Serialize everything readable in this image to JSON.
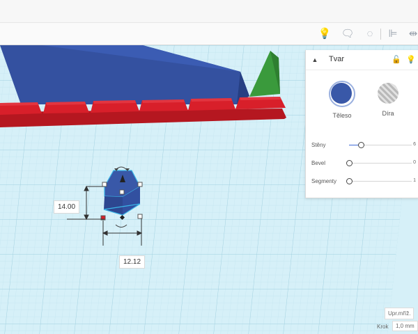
{
  "toolbar": {
    "tools": [
      {
        "name": "lightbulb-icon",
        "glyph": "💡"
      },
      {
        "name": "note-icon",
        "glyph": "🗨"
      },
      {
        "name": "comment-icon",
        "glyph": "◌"
      },
      {
        "name": "align-icon",
        "glyph": "⊫"
      },
      {
        "name": "mirror-icon",
        "glyph": "⇹"
      }
    ]
  },
  "dimensions": {
    "height_value": "14.00",
    "width_value": "12.12"
  },
  "shape_panel": {
    "title": "Tvar",
    "lock_icon": "lock-icon",
    "light_icon": "lightbulb-icon",
    "solid_label": "Těleso",
    "hole_label": "Díra",
    "solid_color": "#3958a8",
    "properties": [
      {
        "label": "Stěny",
        "value": "6",
        "fraction": 0.19
      },
      {
        "label": "Bevel",
        "value": "0",
        "fraction": 0.0
      },
      {
        "label": "Segmenty",
        "value": "1",
        "fraction": 0.0
      }
    ]
  },
  "grid": {
    "settings_label": "Upr.mříž.",
    "snap_label": "Krok",
    "snap_value": "1,0 mm"
  },
  "colors": {
    "accent": "#3f6bd6",
    "blue_shape": "#3451a0",
    "red_shape": "#d81f2a",
    "green_shape": "#3a9a3c",
    "grid_bg": "#d6f0f8"
  }
}
